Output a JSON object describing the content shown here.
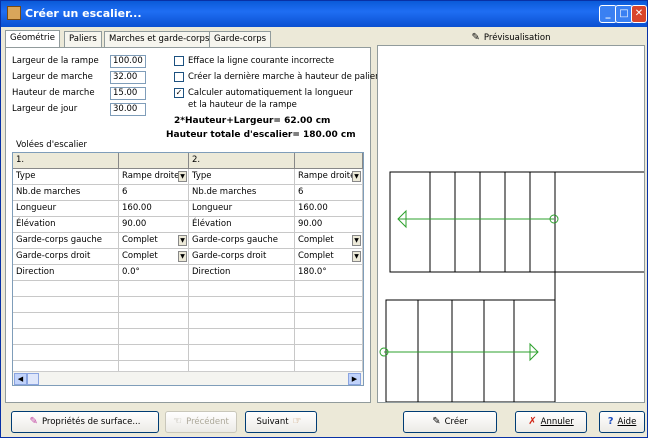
{
  "window": {
    "title": "Créer un escalier..."
  },
  "tabs": [
    "Géométrie",
    "Paliers",
    "Marches et garde-corps",
    "Garde-corps"
  ],
  "fields": [
    {
      "label": "Largeur de la rampe",
      "value": "100.00"
    },
    {
      "label": "Largeur de marche",
      "value": "32.00"
    },
    {
      "label": "Hauteur de marche",
      "value": "15.00"
    },
    {
      "label": "Largeur de jour",
      "value": "30.00"
    }
  ],
  "options": [
    {
      "label": "Efface la ligne courante incorrecte",
      "checked": false
    },
    {
      "label": "Créer la dernière marche à hauteur de palier",
      "checked": false
    },
    {
      "label": "Calculer automatiquement la longueur",
      "label2": "et la hauteur de la rampe",
      "checked": true
    }
  ],
  "formula1": "2*Hauteur+Largeur= 62.00 cm",
  "formula2": "Hauteur totale d'escalier= 180.00 cm",
  "flights_label": "Volées d'escalier",
  "grid": {
    "headers": [
      "1.",
      "2."
    ],
    "rows": [
      {
        "k1": "Type",
        "v1": "Rampe droite",
        "k2": "Type",
        "v2": "Rampe droite",
        "dd": true
      },
      {
        "k1": "Nb.de marches",
        "v1": "6",
        "k2": "Nb.de marches",
        "v2": "6",
        "dd": false
      },
      {
        "k1": "Longueur",
        "v1": "160.00",
        "k2": "Longueur",
        "v2": "160.00",
        "dd": false
      },
      {
        "k1": "Élévation",
        "v1": "90.00",
        "k2": "Élévation",
        "v2": "90.00",
        "dd": false
      },
      {
        "k1": "Garde-corps gauche",
        "v1": "Complet",
        "k2": "Garde-corps gauche",
        "v2": "Complet",
        "dd": true
      },
      {
        "k1": "Garde-corps droit",
        "v1": "Complet",
        "k2": "Garde-corps droit",
        "v2": "Complet",
        "dd": true
      },
      {
        "k1": "Direction",
        "v1": "0.0°",
        "k2": "Direction",
        "v2": "180.0°",
        "dd": false
      }
    ]
  },
  "preview_label": "Prévisualisation",
  "buttons": {
    "surface": "Propriétés de surface...",
    "prev": "Précédent",
    "next": "Suivant",
    "create": "Créer",
    "cancel": "Annuler",
    "help": "Aide"
  }
}
